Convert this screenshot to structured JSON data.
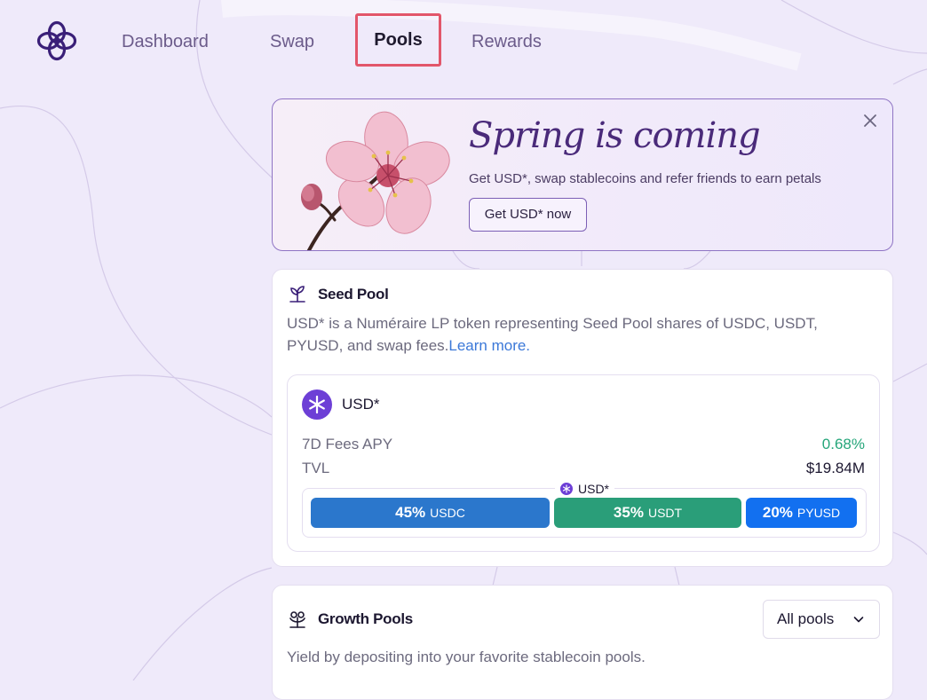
{
  "nav": {
    "items": [
      {
        "label": "Dashboard"
      },
      {
        "label": "Swap"
      },
      {
        "label": "Pools",
        "active": true
      },
      {
        "label": "Rewards"
      }
    ]
  },
  "banner": {
    "title": "Spring is coming",
    "subtitle": "Get USD*, swap stablecoins and refer friends to earn petals",
    "cta_label": "Get USD* now",
    "close_icon": "close-icon",
    "image": "cherry-blossom"
  },
  "seed_pool": {
    "icon": "sprout-icon",
    "title": "Seed Pool",
    "description": "USD* is a Numéraire LP token representing Seed Pool shares of USDC, USDT, PYUSD, and swap fees.",
    "learn_more": "Learn more.",
    "token": {
      "name": "USD*",
      "icon": "asterisk-token-icon"
    },
    "stats": {
      "apy_label": "7D Fees APY",
      "apy_value": "0.68%",
      "tvl_label": "TVL",
      "tvl_value": "$19.84M"
    },
    "composition": {
      "caption": "USD*",
      "segments": [
        {
          "pct": "45%",
          "symbol": "USDC",
          "share": 0.45,
          "color": "#2b77cc"
        },
        {
          "pct": "35%",
          "symbol": "USDT",
          "share": 0.35,
          "color": "#2a9e79"
        },
        {
          "pct": "20%",
          "symbol": "PYUSD",
          "share": 0.2,
          "color": "#1270f0"
        }
      ]
    }
  },
  "growth_pools": {
    "icon": "growth-flower-icon",
    "title": "Growth Pools",
    "filter_value": "All pools",
    "description": "Yield by depositing into your favorite stablecoin pools."
  },
  "colors": {
    "background": "#efeafa",
    "accent_purple": "#6d3fd6",
    "positive_green": "#25a67a",
    "link_blue": "#3b78d8",
    "highlight_red": "#e2566a"
  }
}
